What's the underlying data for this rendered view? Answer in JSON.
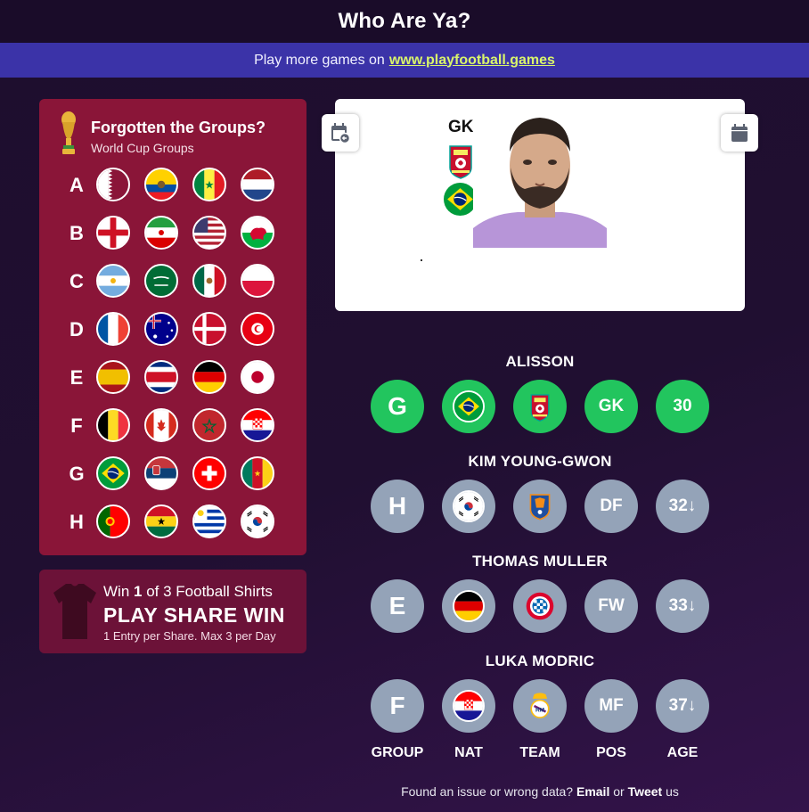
{
  "app": {
    "title": "Who Are Ya?"
  },
  "promo": {
    "text": "Play more games on",
    "link": "www.playfootball.games"
  },
  "groups_panel": {
    "title": "Forgotten the Groups?",
    "subtitle": "World Cup Groups",
    "groups": [
      {
        "letter": "A",
        "teams": [
          "qatar",
          "ecuador",
          "senegal",
          "netherlands"
        ]
      },
      {
        "letter": "B",
        "teams": [
          "england",
          "iran",
          "usa",
          "wales"
        ]
      },
      {
        "letter": "C",
        "teams": [
          "argentina",
          "saudi-arabia",
          "mexico",
          "poland"
        ]
      },
      {
        "letter": "D",
        "teams": [
          "france",
          "australia",
          "denmark",
          "tunisia"
        ]
      },
      {
        "letter": "E",
        "teams": [
          "spain",
          "costa-rica",
          "germany",
          "japan"
        ]
      },
      {
        "letter": "F",
        "teams": [
          "belgium",
          "canada",
          "morocco",
          "croatia"
        ]
      },
      {
        "letter": "G",
        "teams": [
          "brazil",
          "serbia",
          "switzerland",
          "cameroon"
        ]
      },
      {
        "letter": "H",
        "teams": [
          "portugal",
          "ghana",
          "uruguay",
          "south-korea"
        ]
      }
    ]
  },
  "shirts_promo": {
    "line1_pre": "Win ",
    "line1_num": "1",
    "line1_post": " of 3 Football Shirts",
    "line2": "PLAY SHARE WIN",
    "line3": "1 Entry per Share. Max 3 per Day"
  },
  "player_card": {
    "position": "GK",
    "club_icon": "liverpool-crest-icon",
    "nationality_icon": "brazil-flag-icon"
  },
  "guesses": [
    {
      "name": "ALISSON",
      "status": "green",
      "group": {
        "value": "G",
        "status": "green"
      },
      "nat": {
        "flag": "brazil",
        "status": "green"
      },
      "team": {
        "icon": "liverpool",
        "status": "green"
      },
      "pos": {
        "value": "GK",
        "status": "green"
      },
      "age": {
        "value": "30",
        "status": "green"
      }
    },
    {
      "name": "KIM YOUNG-GWON",
      "status": "gray",
      "group": {
        "value": "H",
        "status": "gray"
      },
      "nat": {
        "flag": "south-korea",
        "status": "gray"
      },
      "team": {
        "icon": "ulsan",
        "status": "gray"
      },
      "pos": {
        "value": "DF",
        "status": "gray"
      },
      "age": {
        "value": "32↓",
        "status": "gray"
      }
    },
    {
      "name": "THOMAS MULLER",
      "status": "gray",
      "group": {
        "value": "E",
        "status": "gray"
      },
      "nat": {
        "flag": "germany",
        "status": "gray"
      },
      "team": {
        "icon": "bayern",
        "status": "gray"
      },
      "pos": {
        "value": "FW",
        "status": "gray"
      },
      "age": {
        "value": "33↓",
        "status": "gray"
      }
    },
    {
      "name": "LUKA MODRIC",
      "status": "gray",
      "group": {
        "value": "F",
        "status": "gray"
      },
      "nat": {
        "flag": "croatia",
        "status": "gray"
      },
      "team": {
        "icon": "real-madrid",
        "status": "gray"
      },
      "pos": {
        "value": "MF",
        "status": "gray"
      },
      "age": {
        "value": "37↓",
        "status": "gray"
      }
    }
  ],
  "column_labels": [
    "GROUP",
    "NAT",
    "TEAM",
    "POS",
    "AGE"
  ],
  "footer": {
    "text": "Found an issue or wrong data?",
    "email": "Email",
    "or": "or",
    "tweet": "Tweet",
    "us": "us"
  },
  "colors": {
    "correct": "#22c55e",
    "wrong": "#94a3b8",
    "panel": "#8a1538",
    "promo_bar": "#3b33a8",
    "link": "#d9f56b"
  }
}
